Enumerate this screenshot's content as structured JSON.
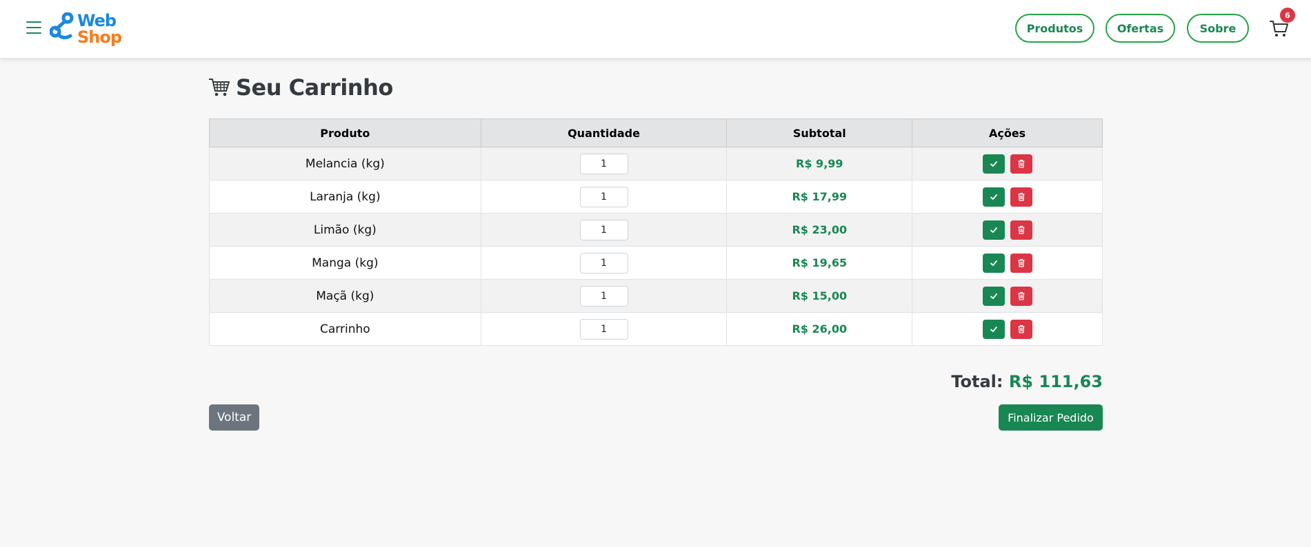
{
  "brand": {
    "word1": "Web",
    "word2": "Shop",
    "color1": "#1a88e0",
    "color2": "#ff7a1a"
  },
  "nav": {
    "items": [
      {
        "label": "Produtos"
      },
      {
        "label": "Ofertas"
      },
      {
        "label": "Sobre"
      }
    ],
    "cart_count": "6"
  },
  "page": {
    "title": "Seu Carrinho"
  },
  "table": {
    "headers": [
      "Produto",
      "Quantidade",
      "Subtotal",
      "Ações"
    ],
    "rows": [
      {
        "product": "Melancia (kg)",
        "quantity": "1",
        "subtotal": "R$ 9,99"
      },
      {
        "product": "Laranja (kg)",
        "quantity": "1",
        "subtotal": "R$ 17,99"
      },
      {
        "product": "Limão (kg)",
        "quantity": "1",
        "subtotal": "R$ 23,00"
      },
      {
        "product": "Manga (kg)",
        "quantity": "1",
        "subtotal": "R$ 19,65"
      },
      {
        "product": "Maçã (kg)",
        "quantity": "1",
        "subtotal": "R$ 15,00"
      },
      {
        "product": "Carrinho",
        "quantity": "1",
        "subtotal": "R$ 26,00"
      }
    ]
  },
  "summary": {
    "total_label": "Total:",
    "total_value": "R$ 111,63"
  },
  "actions": {
    "back_label": "Voltar",
    "finish_label": "Finalizar Pedido"
  },
  "colors": {
    "accent": "#198754",
    "danger": "#dc3545",
    "secondary": "#6c757d"
  }
}
